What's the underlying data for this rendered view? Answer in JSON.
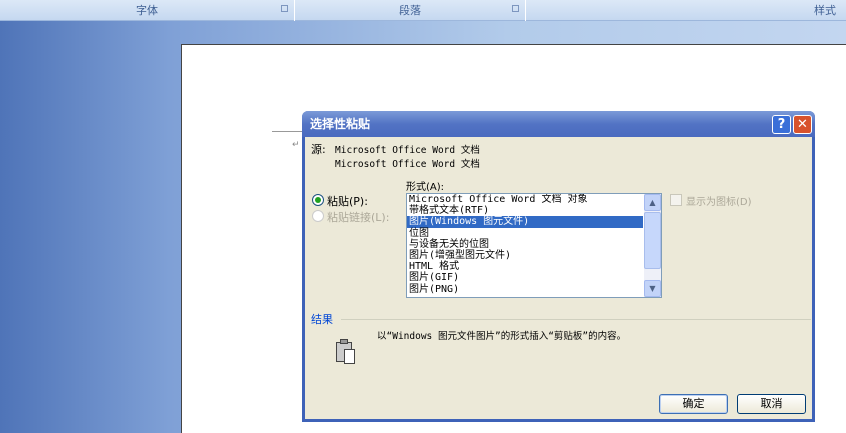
{
  "ribbon": {
    "groups": [
      "字体",
      "段落",
      "样式"
    ]
  },
  "dialog": {
    "title": "选择性粘贴",
    "help_label": "?",
    "close_label": "✕",
    "source_label": "源:",
    "source_lines": [
      "Microsoft Office Word 文档",
      "Microsoft Office Word 文档"
    ],
    "format_label": "形式(A):",
    "paste_label": "粘贴(P):",
    "paste_link_label": "粘贴链接(L):",
    "display_icon_label": "显示为图标(D)",
    "formats": [
      "Microsoft Office Word 文档 对象",
      "带格式文本(RTF)",
      "图片(Windows 图元文件)",
      "位图",
      "与设备无关的位图",
      "图片(增强型图元文件)",
      "HTML 格式",
      "图片(GIF)",
      "图片(PNG)"
    ],
    "selected_index": 2,
    "result_label": "结果",
    "result_text": "以“Windows 图元文件图片”的形式插入“剪贴板”的内容。",
    "ok_label": "确定",
    "cancel_label": "取消"
  }
}
